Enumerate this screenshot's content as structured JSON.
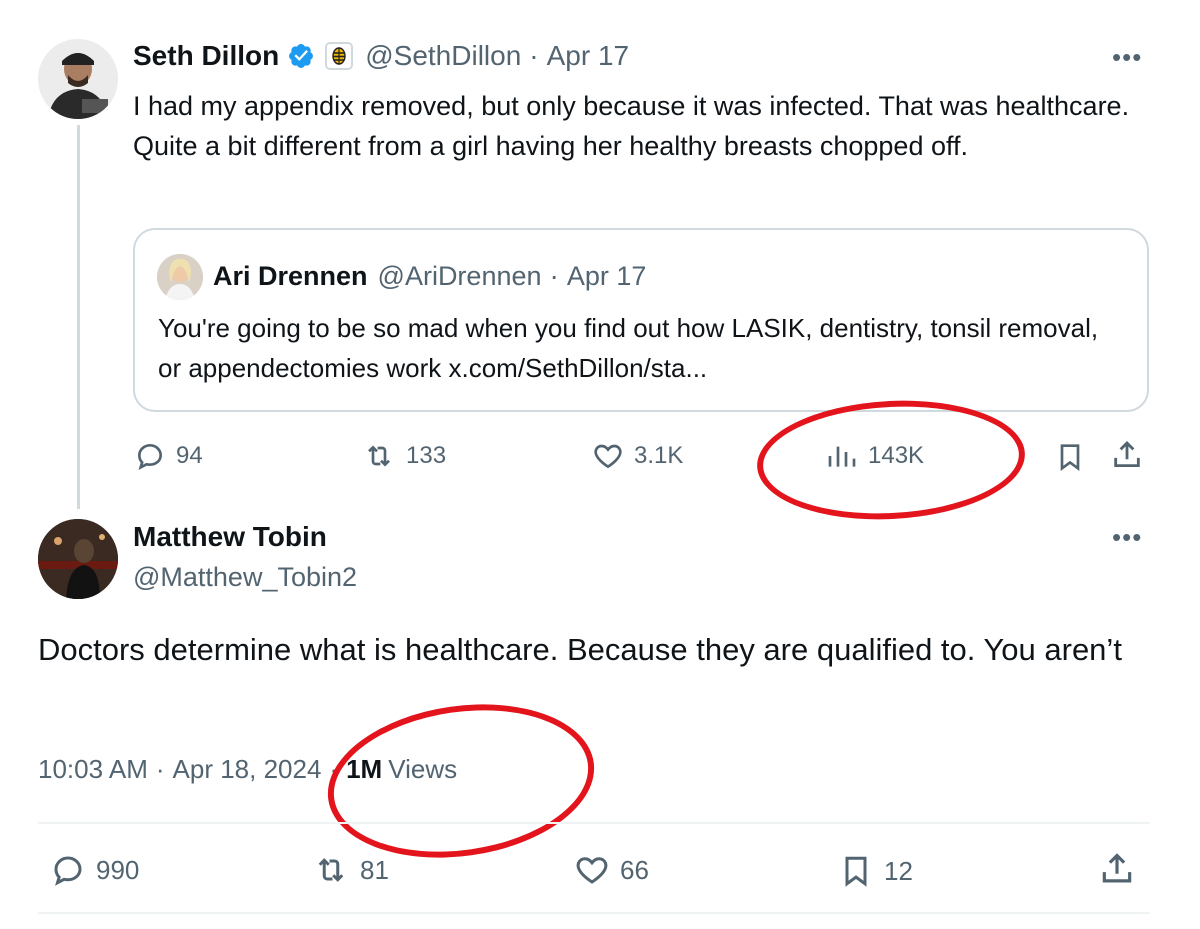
{
  "first_tweet": {
    "author_name": "Seth Dillon",
    "handle": "@SethDillon",
    "date": "Apr 17",
    "text": "I had my appendix removed, but only because it was infected. That was healthcare. Quite a bit different from a girl having her healthy breasts chopped off.",
    "quoted": {
      "author_name": "Ari Drennen",
      "handle": "@AriDrennen",
      "date": "Apr 17",
      "text": "You're going to be so mad when you find out how LASIK, dentistry, tonsil removal, or appendectomies work x.com/SethDillon/sta..."
    },
    "actions": {
      "replies": "94",
      "reposts": "133",
      "likes": "3.1K",
      "views": "143K"
    }
  },
  "main_tweet": {
    "author_name": "Matthew Tobin",
    "handle": "@Matthew_Tobin2",
    "text": "Doctors determine what is healthcare. Because they are qualified to. You aren’t",
    "time": "10:03 AM",
    "date": "Apr 18, 2024",
    "views_count": "1M",
    "views_label": "Views",
    "actions": {
      "replies": "990",
      "reposts": "81",
      "likes": "66",
      "bookmarks": "12"
    }
  },
  "colors": {
    "verified": "#1d9bf0",
    "annotation": "#e3141b",
    "muted": "#536471",
    "border": "#cfd9de"
  },
  "icons": [
    "verified-badge-icon",
    "organization-badge-icon",
    "more-icon",
    "reply-icon",
    "repost-icon",
    "like-icon",
    "views-icon",
    "bookmark-icon",
    "share-icon"
  ]
}
